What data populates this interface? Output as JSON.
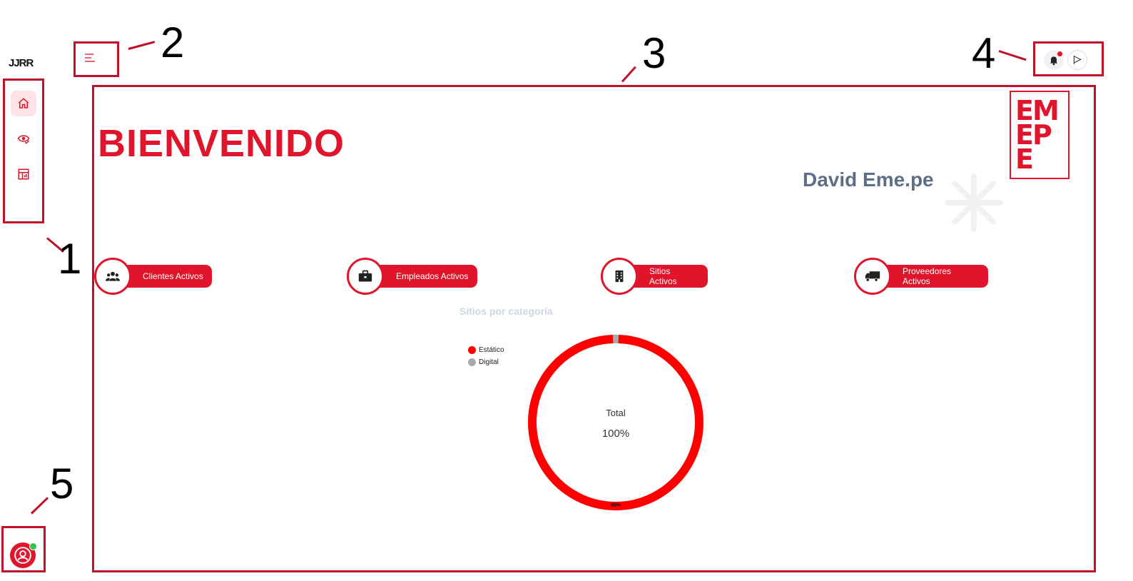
{
  "app": {
    "logo_text": "JJRR"
  },
  "sidebar": {
    "items": [
      {
        "icon": "home-icon",
        "active": true
      },
      {
        "icon": "eye-check-icon",
        "active": false
      },
      {
        "icon": "report-table-icon",
        "active": false
      }
    ]
  },
  "header": {
    "menu_icon": "hamburger-menu-icon",
    "notifications_icon": "bell-icon",
    "flag_icon": "flag-icon"
  },
  "main": {
    "welcome": "BIENVENIDO",
    "user_name": "David Eme.pe",
    "brand_logo_lines": [
      "EM",
      "EP",
      "E"
    ],
    "stats": [
      {
        "label": "Clientes Activos",
        "icon": "users-icon"
      },
      {
        "label": "Empleados Activos",
        "icon": "briefcase-icon"
      },
      {
        "label": "Sitios Activos",
        "icon": "building-icon"
      },
      {
        "label": "Proveedores Activos",
        "icon": "truck-icon"
      }
    ]
  },
  "chart_data": {
    "type": "pie",
    "title": "Sitios por categoría",
    "categories": [
      "Estático",
      "Digital"
    ],
    "values": [
      99,
      1
    ],
    "colors": [
      "#ff0000",
      "#aaaaaa"
    ],
    "center_label": "Total",
    "center_value": "100%",
    "slice_label": "99%",
    "legend_position": "left"
  },
  "annotations": [
    "1",
    "2",
    "3",
    "4",
    "5"
  ],
  "colors": {
    "accent": "#e0142a",
    "annotation": "#c0102a",
    "user_name": "#5c6f86"
  }
}
